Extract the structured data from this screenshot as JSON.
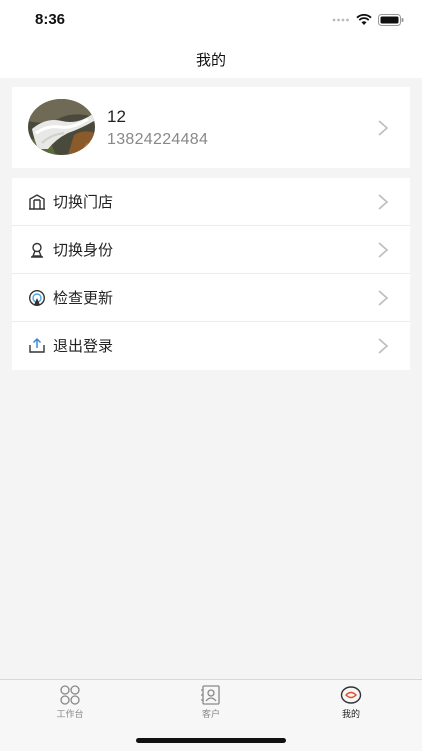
{
  "status_bar": {
    "time": "8:36"
  },
  "header": {
    "title": "我的"
  },
  "profile": {
    "name": "12",
    "phone": "13824224484"
  },
  "menu": {
    "items": [
      {
        "label": "切换门店",
        "icon": "store-icon"
      },
      {
        "label": "切换身份",
        "icon": "person-icon"
      },
      {
        "label": "检查更新",
        "icon": "update-icon"
      },
      {
        "label": "退出登录",
        "icon": "logout-icon"
      }
    ]
  },
  "tabbar": {
    "items": [
      {
        "label": "工作台",
        "icon": "workbench-icon"
      },
      {
        "label": "客户",
        "icon": "customer-icon"
      },
      {
        "label": "我的",
        "icon": "mine-icon",
        "active": true
      }
    ]
  },
  "colors": {
    "accent": "#e0502a",
    "background": "#f4f4f4",
    "text": "#222222",
    "muted": "#888888"
  }
}
